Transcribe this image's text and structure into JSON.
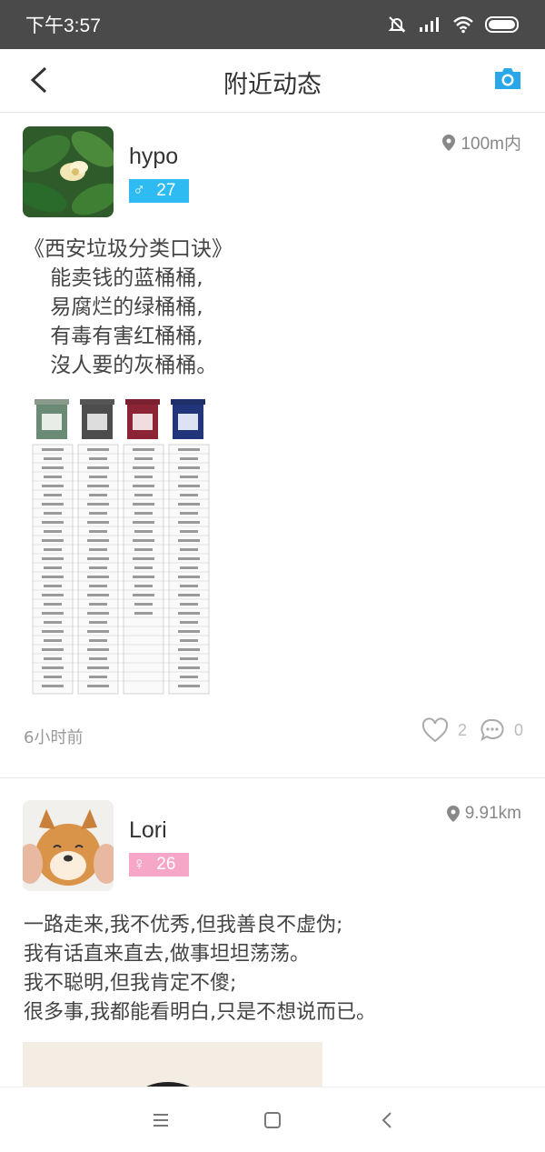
{
  "status_bar": {
    "time": "下午3:57"
  },
  "nav": {
    "title": "附近动态",
    "back_icon": "chevron-left-icon",
    "camera_icon": "camera-icon",
    "accent_color": "#2aa7e8"
  },
  "posts": [
    {
      "username": "hypo",
      "gender": "male",
      "gender_symbol": "♂",
      "age": "27",
      "distance": "100m内",
      "text": "《西安垃圾分类口诀》\n    能卖钱的蓝桶桶,\n    易腐烂的绿桶桶,\n    有毒有害红桶桶,\n    沒人要的灰桶桶。",
      "time_ago": "6小时前",
      "likes": "2",
      "comments": "0"
    },
    {
      "username": "Lori",
      "gender": "female",
      "gender_symbol": "♀",
      "age": "26",
      "distance": "9.91km",
      "text": "一路走来,我不优秀,但我善良不虚伪;\n我有话直来直去,做事坦坦荡荡。\n我不聪明,但我肯定不傻;\n很多事,我都能看明白,只是不想说而已。"
    }
  ],
  "colors": {
    "male_badge": "#2ebbf2",
    "female_badge": "#f6a6c7"
  }
}
